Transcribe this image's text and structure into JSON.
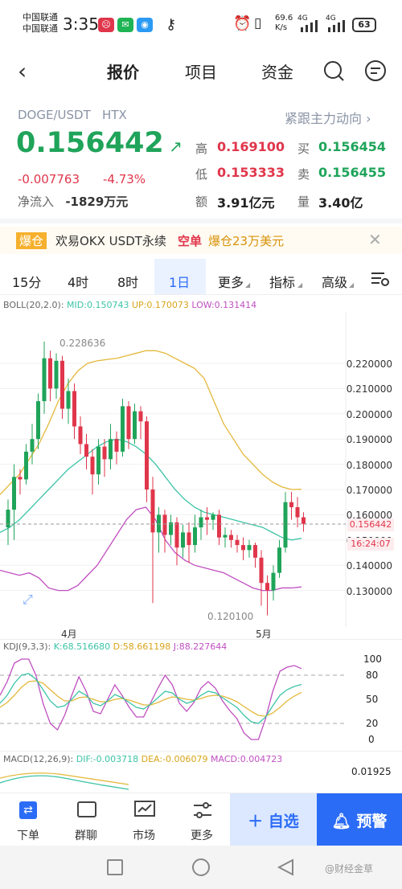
{
  "status_bar": {
    "carrier_1": "中国联通",
    "carrier_2": "中国联通",
    "time": "3:35",
    "speed_value": "69.6",
    "speed_unit": "K/s",
    "network_1": "4G",
    "network_2": "4G",
    "battery": "63"
  },
  "header": {
    "tabs": [
      "报价",
      "项目",
      "资金"
    ],
    "active_tab": "报价"
  },
  "quote": {
    "pair": "DOGE/USDT",
    "exchange": "HTX",
    "follow_link": "紧跟主力动向 ›",
    "price": "0.156442",
    "change": "-0.007763",
    "change_pct": "-4.73%",
    "netflow_label": "净流入",
    "netflow_value": "-1829万元",
    "stats": {
      "high_label": "高",
      "high": "0.169100",
      "bid_label": "买",
      "bid": "0.156454",
      "low_label": "低",
      "low": "0.153333",
      "ask_label": "卖",
      "ask": "0.156455",
      "amount_label": "额",
      "amount": "3.91亿元",
      "volume_label": "量",
      "volume": "3.40亿"
    }
  },
  "banner": {
    "tag": "爆仓",
    "text": "欢易OKX USDT永续",
    "side": "空单",
    "detail": "爆仓23万美元"
  },
  "period_tabs": [
    "15分",
    "4时",
    "8时",
    "1日",
    "更多",
    "指标",
    "高级"
  ],
  "active_period": "1日",
  "boll": {
    "label": "BOLL(20,2.0):",
    "mid": "MID:0.150743",
    "up": "UP:0.170073",
    "low": "LOW:0.131414",
    "max_label": "0.228636",
    "min_label": "0.120100",
    "price_tag": "0.156442",
    "time_tag": "16:24:07",
    "y_ticks": [
      "0.220000",
      "0.210000",
      "0.200000",
      "0.190000",
      "0.180000",
      "0.170000",
      "0.160000",
      "0.150000",
      "0.140000",
      "0.130000"
    ],
    "x_labels": [
      "4月",
      "5月"
    ]
  },
  "kdj": {
    "label": "KDJ(9,3,3):",
    "k": "K:68.516680",
    "d": "D:58.661198",
    "j": "J:88.227644",
    "y_ticks": [
      "100",
      "80",
      "50",
      "20",
      "0"
    ]
  },
  "macd": {
    "label": "MACD(12,26,9):",
    "dif": "DIF:-0.003718",
    "dea": "DEA:-0.006079",
    "macd": "MACD:0.004723",
    "y_tick": "0.01925"
  },
  "bottom_nav": {
    "items": [
      "下单",
      "群聊",
      "市场",
      "更多"
    ],
    "add_watch": "自选",
    "alert": "预警"
  },
  "watermark": "@财经金草",
  "colors": {
    "up": "#e0364b",
    "down": "#1fa45a",
    "accent": "#2b6cf6",
    "mid": "#3cc4a6",
    "upper": "#e4b83a",
    "lower": "#c04fc0"
  }
}
